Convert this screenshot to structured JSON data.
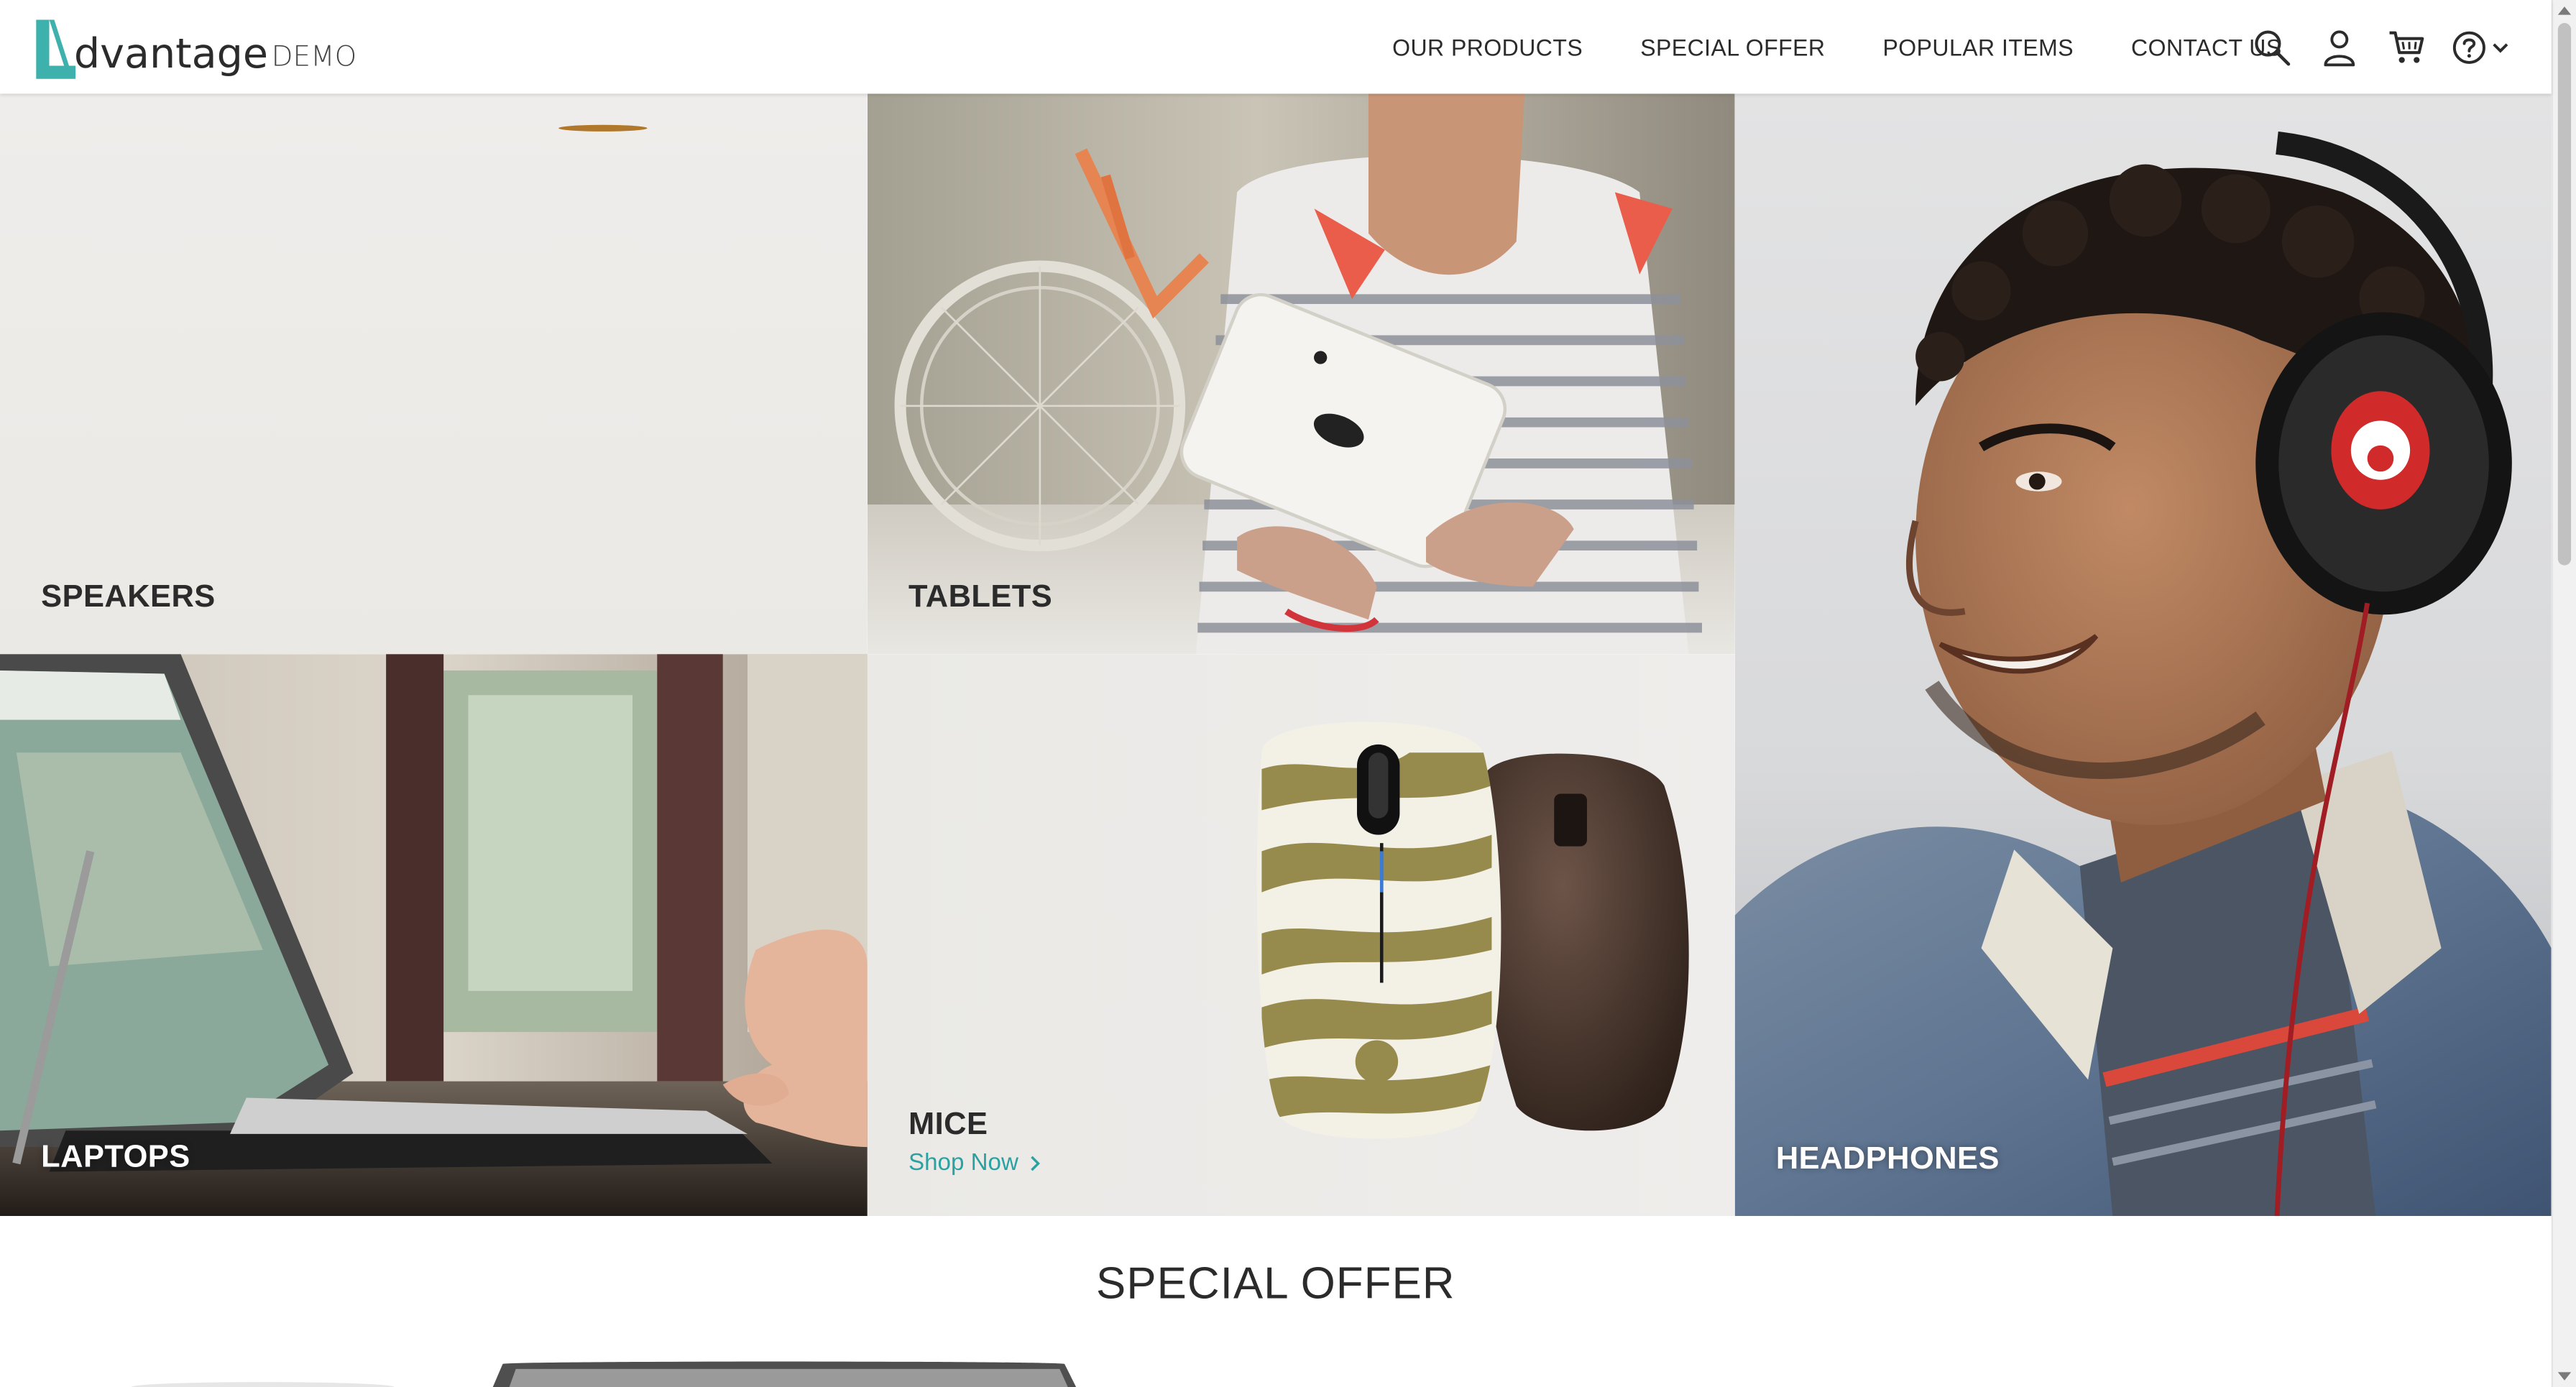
{
  "header": {
    "logo_word": "dvantage",
    "logo_demo": "DEMO",
    "nav": [
      "OUR PRODUCTS",
      "SPECIAL OFFER",
      "POPULAR ITEMS",
      "CONTACT US"
    ],
    "icons": [
      "search-icon",
      "user-icon",
      "cart-icon",
      "help-icon"
    ]
  },
  "categories": {
    "speakers": {
      "label": "SPEAKERS"
    },
    "tablets": {
      "label": "TABLETS"
    },
    "headphones": {
      "label": "HEADPHONES"
    },
    "laptops": {
      "label": "LAPTOPS"
    },
    "mice": {
      "label": "MICE",
      "cta": "Shop Now"
    }
  },
  "special_offer": {
    "title": "SPECIAL OFFER"
  },
  "colors": {
    "accent": "#2ba2a2",
    "text": "#2b2b2b"
  }
}
